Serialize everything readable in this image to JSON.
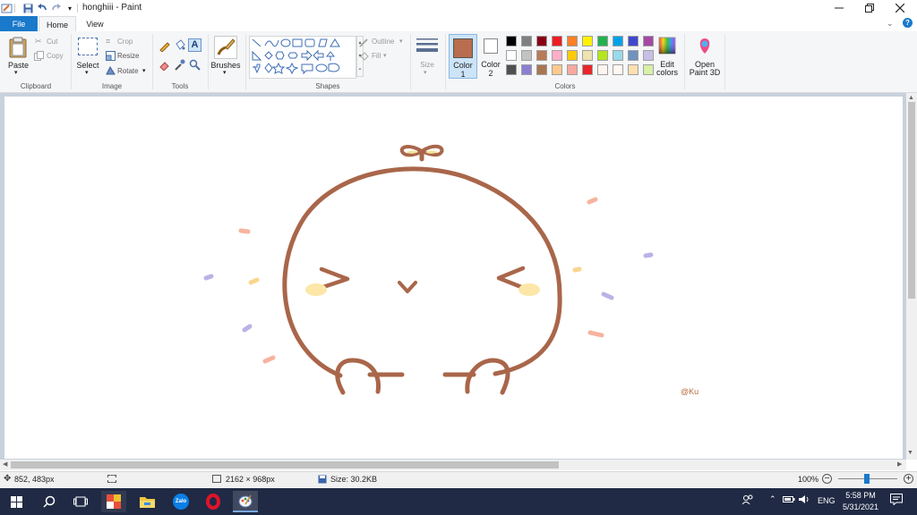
{
  "window": {
    "title": "honghiii - Paint"
  },
  "tabs": [
    {
      "label": "File",
      "active": false,
      "file": true
    },
    {
      "label": "Home",
      "active": true
    },
    {
      "label": "View",
      "active": false
    }
  ],
  "clipboard": {
    "paste": "Paste",
    "cut": "Cut",
    "copy": "Copy",
    "group": "Clipboard"
  },
  "image": {
    "select": "Select",
    "crop": "Crop",
    "resize": "Resize",
    "rotate": "Rotate",
    "group": "Image"
  },
  "tools": {
    "group": "Tools"
  },
  "brushes": {
    "label": "Brushes"
  },
  "shapes": {
    "outline": "Outline",
    "fill": "Fill",
    "group": "Shapes"
  },
  "size": {
    "label": "Size"
  },
  "colors": {
    "color1_label": "Color",
    "color1_num": "1",
    "color2_label": "Color",
    "color2_num": "2",
    "color1_value": "#b76d4e",
    "color2_value": "#ffffff",
    "edit_label": "Edit",
    "edit_label2": "colors",
    "group": "Colors",
    "palette": [
      [
        "#000000",
        "#7f7f7f",
        "#880015",
        "#ed1c24",
        "#ff7f27",
        "#fff200",
        "#22b14c",
        "#00a2e8",
        "#3f48cc",
        "#a349a4"
      ],
      [
        "#ffffff",
        "#c3c3c3",
        "#b97a57",
        "#ffaec9",
        "#ffc90e",
        "#efe4b0",
        "#b5e61d",
        "#99d9ea",
        "#7092be",
        "#c8bfe7"
      ],
      [
        "#505050",
        "#8a7fd2",
        "#a87652",
        "#ffc98e",
        "#f8a9a0",
        "#e8262b",
        "#fdf4f0",
        "#fff7f0",
        "#ffe0b0",
        "#d8f0a8"
      ]
    ]
  },
  "paint3d": {
    "label": "Open",
    "label2": "Paint 3D"
  },
  "canvas": {
    "signature": "@Ku",
    "stroke_color": "#a9664a"
  },
  "status": {
    "cursor": "852, 483px",
    "dimensions": "2162 × 968px",
    "size": "Size: 30.2KB",
    "zoom": "100%"
  },
  "taskbar": {
    "language": "ENG",
    "time": "5:58 PM",
    "date": "5/31/2021"
  }
}
